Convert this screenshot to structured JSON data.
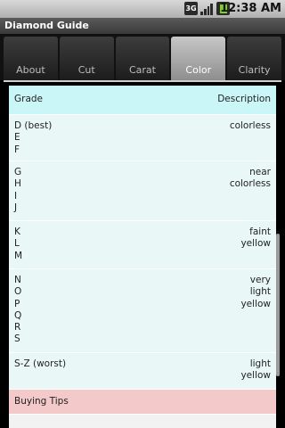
{
  "status": {
    "network": "3G",
    "time": "12:38 AM"
  },
  "app": {
    "title": "Diamond Guide"
  },
  "tabs": [
    {
      "label": "About",
      "active": false
    },
    {
      "label": "Cut",
      "active": false
    },
    {
      "label": "Carat",
      "active": false
    },
    {
      "label": "Color",
      "active": true
    },
    {
      "label": "Clarity",
      "active": false
    }
  ],
  "table": {
    "header": {
      "grade": "Grade",
      "description": "Description"
    },
    "rows": [
      {
        "grade": "D (best)\nE\nF",
        "description": "colorless"
      },
      {
        "grade": "G\nH\nI\nJ",
        "description": "near\ncolorless"
      },
      {
        "grade": "K\nL\nM",
        "description": "faint\nyellow"
      },
      {
        "grade": "N\nO\nP\nQ\nR\nS",
        "description": "very\nlight\nyellow"
      },
      {
        "grade": "S-Z (worst)",
        "description": "light\nyellow"
      }
    ]
  },
  "buying_tips": {
    "label": "Buying Tips"
  },
  "colors": {
    "header_bg": "#cbf6f7",
    "row_bg": "#e9f7f7",
    "tips_bg": "#f3c9c9",
    "active_tab": "#a9a9a9"
  }
}
